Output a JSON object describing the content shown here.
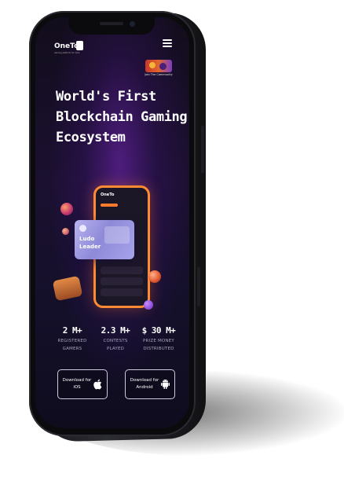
{
  "app": {
    "brand": "OneTo",
    "tagline": "Gaming platform for India"
  },
  "header": {
    "join_label": "Join The Community"
  },
  "hero": {
    "title_line1": "World's First",
    "title_line2": "Blockchain Gaming",
    "title_line3": "Ecosystem"
  },
  "illustration": {
    "card_line1": "Ludo",
    "card_line2": "Leader",
    "mini_app_brand": "OneTo"
  },
  "stats": [
    {
      "value": "2 M+",
      "label_line1": "REGISTERED",
      "label_line2": "GAMERS"
    },
    {
      "value": "2.3 M+",
      "label_line1": "CONTESTS",
      "label_line2": "PLAYED"
    },
    {
      "value": "$ 30 M+",
      "label_line1": "PRIZE MONEY",
      "label_line2": "DISTRIBUTED"
    }
  ],
  "downloads": {
    "ios_line1": "Download for",
    "ios_line2": "iOS",
    "android_line1": "Download for",
    "android_line2": "Android"
  },
  "colors": {
    "screen_bg": "#140f24",
    "accent_orange": "#ff8a34",
    "accent_purple": "#7a3cc4",
    "text_primary": "#ffffff",
    "text_muted": "#a8a3b8"
  },
  "icons": [
    "menu-icon",
    "apple-icon",
    "android-icon"
  ]
}
